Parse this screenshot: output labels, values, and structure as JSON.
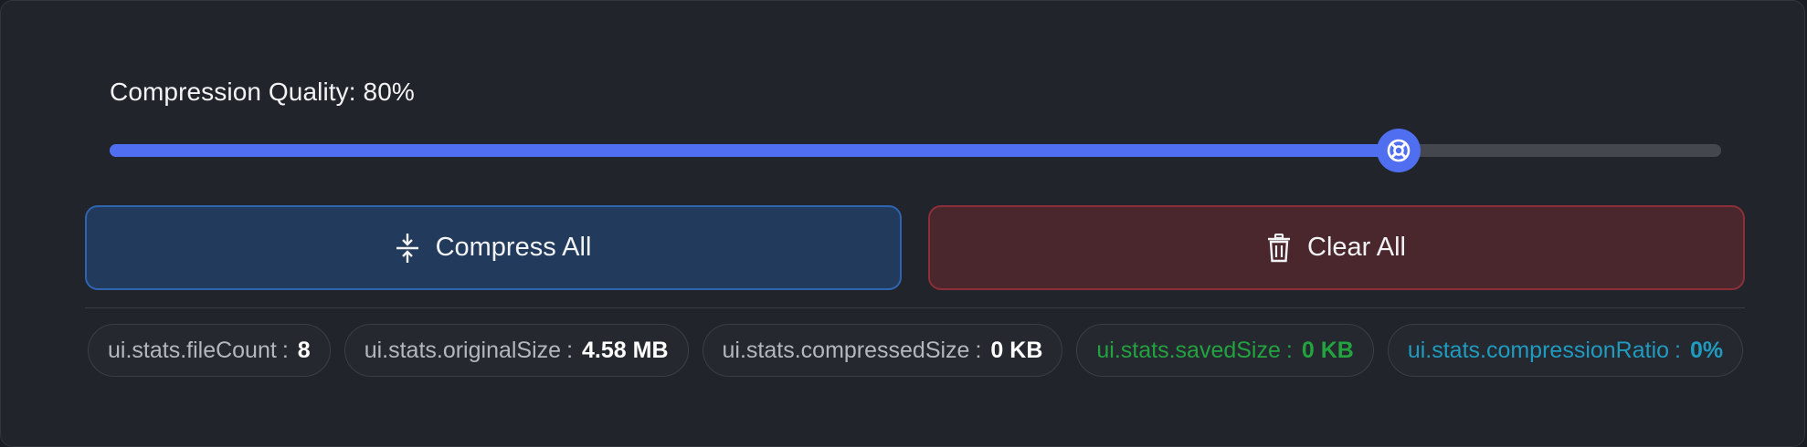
{
  "quality": {
    "label": "Compression Quality: 80%",
    "value_percent": 80,
    "thumb_icon": "life-ring-icon"
  },
  "actions": {
    "compress_label": "Compress All",
    "compress_icon": "compress-arrows-icon",
    "clear_label": "Clear All",
    "clear_icon": "trash-icon"
  },
  "stats": [
    {
      "label": "ui.stats.fileCount",
      "sep": ":",
      "value": "8"
    },
    {
      "label": "ui.stats.originalSize",
      "sep": ":",
      "value": "4.58 MB"
    },
    {
      "label": "ui.stats.compressedSize",
      "sep": ":",
      "value": "0 KB"
    },
    {
      "label": "ui.stats.savedSize",
      "sep": ":",
      "value": "0 KB"
    },
    {
      "label": "ui.stats.compressionRatio",
      "sep": ":",
      "value": "0%"
    }
  ],
  "colors": {
    "accent": "#4f6ff0",
    "compress_border": "#2f65b0",
    "clear_border": "#8c2f38",
    "saved_green": "#22a33f",
    "ratio_cyan": "#1f9bc0"
  }
}
